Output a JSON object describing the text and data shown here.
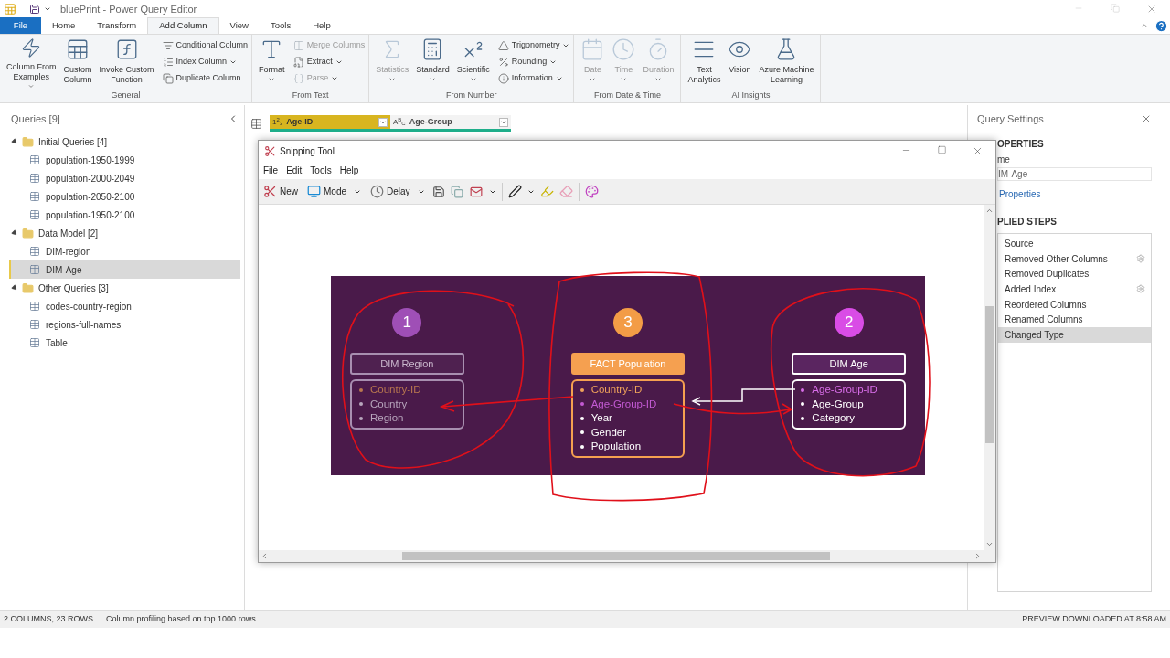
{
  "window": {
    "title": "bluePrint - Power Query Editor"
  },
  "ribbon_tabs": [
    {
      "label": "File",
      "kind": "file",
      "selected": false
    },
    {
      "label": "Home",
      "kind": "tab",
      "selected": false
    },
    {
      "label": "Transform",
      "kind": "tab",
      "selected": false
    },
    {
      "label": "Add Column",
      "kind": "tab",
      "selected": true
    },
    {
      "label": "View",
      "kind": "tab",
      "selected": false
    },
    {
      "label": "Tools",
      "kind": "tab",
      "selected": false
    },
    {
      "label": "Help",
      "kind": "tab",
      "selected": false
    }
  ],
  "ribbon_groups": [
    {
      "label": "General",
      "large": [
        {
          "lines": [
            "Column From",
            "Examples"
          ],
          "dropdown": true,
          "disabled": false
        },
        {
          "lines": [
            "Custom",
            "Column"
          ],
          "dropdown": false,
          "disabled": false
        },
        {
          "lines": [
            "Invoke Custom",
            "Function"
          ],
          "dropdown": false,
          "disabled": false
        }
      ],
      "small": [
        {
          "label": "Conditional Column",
          "dropdown": false,
          "disabled": false
        },
        {
          "label": "Index Column",
          "dropdown": true,
          "disabled": false
        },
        {
          "label": "Duplicate Column",
          "dropdown": false,
          "disabled": false
        }
      ]
    },
    {
      "label": "From Text",
      "large": [
        {
          "lines": [
            "Format"
          ],
          "dropdown": true,
          "disabled": false
        }
      ],
      "small": [
        {
          "label": "Merge Columns",
          "dropdown": false,
          "disabled": true
        },
        {
          "label": "Extract",
          "dropdown": true,
          "disabled": false
        },
        {
          "label": "Parse",
          "dropdown": true,
          "disabled": true
        }
      ]
    },
    {
      "label": "From Number",
      "large": [
        {
          "lines": [
            "Statistics"
          ],
          "dropdown": true,
          "disabled": true
        },
        {
          "lines": [
            "Standard"
          ],
          "dropdown": true,
          "disabled": false
        },
        {
          "lines": [
            "Scientific"
          ],
          "dropdown": true,
          "disabled": false
        }
      ],
      "small": [
        {
          "label": "Trigonometry",
          "dropdown": true,
          "disabled": false
        },
        {
          "label": "Rounding",
          "dropdown": true,
          "disabled": false
        },
        {
          "label": "Information",
          "dropdown": true,
          "disabled": false
        }
      ]
    },
    {
      "label": "From Date & Time",
      "large": [
        {
          "lines": [
            "Date"
          ],
          "dropdown": true,
          "disabled": true
        },
        {
          "lines": [
            "Time"
          ],
          "dropdown": true,
          "disabled": true
        },
        {
          "lines": [
            "Duration"
          ],
          "dropdown": true,
          "disabled": true
        }
      ]
    },
    {
      "label": "AI Insights",
      "large": [
        {
          "lines": [
            "Text",
            "Analytics"
          ],
          "dropdown": false,
          "disabled": false
        },
        {
          "lines": [
            "Vision"
          ],
          "dropdown": false,
          "disabled": false
        },
        {
          "lines": [
            "Azure Machine",
            "Learning"
          ],
          "dropdown": false,
          "disabled": false
        }
      ]
    }
  ],
  "queries": {
    "title": "Queries [9]",
    "groups": [
      {
        "label": "Initial Queries [4]",
        "expanded": true,
        "children": [
          {
            "label": "population-1950-1999",
            "selected": false
          },
          {
            "label": "population-2000-2049",
            "selected": false
          },
          {
            "label": "population-2050-2100",
            "selected": false
          },
          {
            "label": "population-1950-2100",
            "selected": false
          }
        ]
      },
      {
        "label": "Data Model [2]",
        "expanded": true,
        "children": [
          {
            "label": "DIM-region",
            "selected": false
          },
          {
            "label": "DIM-Age",
            "selected": true
          }
        ]
      },
      {
        "label": "Other Queries [3]",
        "expanded": true,
        "children": [
          {
            "label": "codes-country-region",
            "selected": false
          },
          {
            "label": "regions-full-names",
            "selected": false
          },
          {
            "label": "Table",
            "selected": false
          }
        ]
      }
    ]
  },
  "columns": [
    {
      "type_glyph": "1$^{2}$$_{3}$",
      "label": "Age-ID",
      "selected": true
    },
    {
      "type_glyph": "A$^{B}$$_{C}$",
      "label": "Age-Group",
      "selected": false
    }
  ],
  "snipping_tool": {
    "title": "Snipping Tool",
    "menu": [
      "File",
      "Edit",
      "Tools",
      "Help"
    ],
    "toolbar": [
      {
        "label": "New",
        "dropdown": false
      },
      {
        "label": "Mode",
        "dropdown": true
      },
      {
        "label": "Delay",
        "dropdown": true
      }
    ],
    "diagram": {
      "tables": [
        {
          "number": "1",
          "color": "#9f4fb6",
          "kind": "muted",
          "title": "DIM Region",
          "fields": [
            {
              "name": "Country-ID",
              "color": "#b9774f"
            },
            {
              "name": "Country",
              "color": "#b8a6bd"
            },
            {
              "name": "Region",
              "color": "#b8a6bd"
            }
          ]
        },
        {
          "number": "3",
          "color": "#f39c46",
          "kind": "fact",
          "title": "FACT Population",
          "fields": [
            {
              "name": "Country-ID",
              "color": "#f0a35a"
            },
            {
              "name": "Age-Group-ID",
              "color": "#c35ad3"
            },
            {
              "name": "Year",
              "color": "#ffffff"
            },
            {
              "name": "Gender",
              "color": "#ffffff"
            },
            {
              "name": "Population",
              "color": "#ffffff"
            }
          ]
        },
        {
          "number": "2",
          "color": "#d94ce6",
          "kind": "dim",
          "title": "DIM Age",
          "fields": [
            {
              "name": "Age-Group-ID",
              "color": "#d86ee9"
            },
            {
              "name": "Age-Group",
              "color": "#ffffff"
            },
            {
              "name": "Category",
              "color": "#ffffff"
            }
          ]
        }
      ]
    }
  },
  "query_settings": {
    "title": "Query Settings",
    "properties_heading": "OPERTIES",
    "name_label": "me",
    "name_value": "IM-Age",
    "properties_link": "Properties",
    "steps_heading": "PLIED STEPS",
    "steps": [
      {
        "label": "Source",
        "settings": false,
        "selected": false
      },
      {
        "label": "Removed Other Columns",
        "settings": true,
        "selected": false
      },
      {
        "label": "Removed Duplicates",
        "settings": false,
        "selected": false
      },
      {
        "label": "Added Index",
        "settings": true,
        "selected": false
      },
      {
        "label": "Reordered Columns",
        "settings": false,
        "selected": false
      },
      {
        "label": "Renamed Columns",
        "settings": false,
        "selected": false
      },
      {
        "label": "Changed Type",
        "settings": false,
        "selected": true
      }
    ]
  },
  "status_bar": {
    "left": [
      "2 COLUMNS, 23 ROWS",
      "Column profiling based on top 1000 rows"
    ],
    "right": "PREVIEW DOWNLOADED AT 8:58 AM"
  }
}
